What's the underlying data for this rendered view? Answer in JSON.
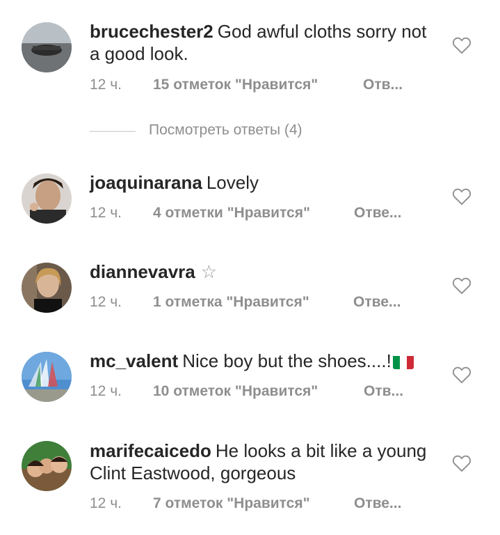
{
  "comments": [
    {
      "username": "brucechester2",
      "text": "God awful cloths sorry not a good look.",
      "time": "12 ч.",
      "likes": "15 отметок \"Нравится\"",
      "reply": "Отв..."
    },
    {
      "username": "joaquinarana",
      "text": "Lovely",
      "time": "12 ч.",
      "likes": "4 отметки \"Нравится\"",
      "reply": "Отве..."
    },
    {
      "username": "diannevavra",
      "text": "☆",
      "time": "12 ч.",
      "likes": "1 отметка \"Нравится\"",
      "reply": "Отве..."
    },
    {
      "username": "mc_valent",
      "text": "Nice boy but the shoes....!",
      "time": "12 ч.",
      "likes": "10 отметок \"Нравится\"",
      "reply": "Отв..."
    },
    {
      "username": "marifecaicedo",
      "text": "He looks a bit like a young Clint Eastwood, gorgeous",
      "time": "12 ч.",
      "likes": "7 отметок \"Нравится\"",
      "reply": "Отве..."
    }
  ],
  "view_replies": "Посмотреть ответы (4)",
  "icons": {
    "heart": "heart-outline-icon",
    "flag": "italy-flag-emoji",
    "star": "star-emoji"
  },
  "colors": {
    "text": "#262626",
    "secondary": "#8e8e8e",
    "flag": [
      "#009246",
      "#ffffff",
      "#ce2b37"
    ]
  }
}
